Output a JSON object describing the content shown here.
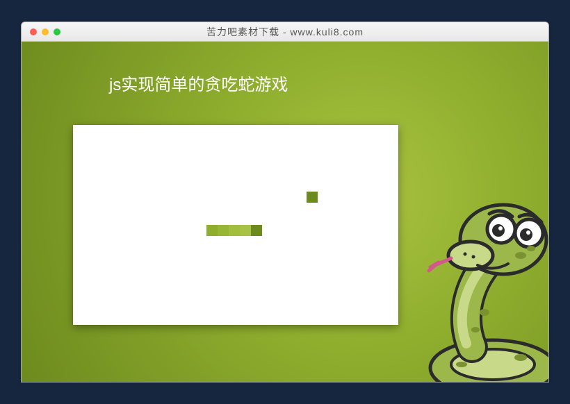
{
  "window": {
    "title": "苦力吧素材下载 - www.kuli8.com"
  },
  "page": {
    "title": "js实现简单的贪吃蛇游戏"
  },
  "game": {
    "cell_size": 16,
    "board": {
      "cols": 29,
      "rows": 18
    },
    "snake_color_gradient": [
      "#8fae2e",
      "#98b635",
      "#a1be3d",
      "#a9c245",
      "#b1c84d"
    ],
    "head_color": "#6d8a1e",
    "snake": [
      {
        "col": 12,
        "row": 9
      },
      {
        "col": 13,
        "row": 9
      },
      {
        "col": 14,
        "row": 9
      },
      {
        "col": 15,
        "row": 9
      },
      {
        "col": 16,
        "row": 9
      }
    ],
    "food": {
      "col": 21,
      "row": 6,
      "color": "#6d8a1e"
    }
  }
}
